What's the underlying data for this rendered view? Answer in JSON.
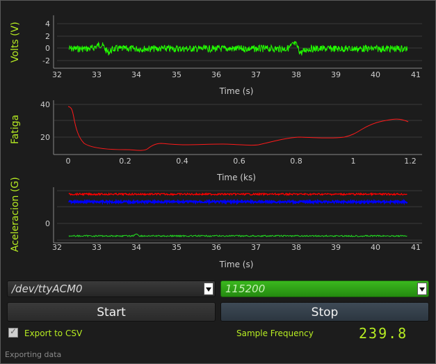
{
  "plots": {
    "volts": {
      "ylabel": "Volts (V)",
      "xlabel": "Time (s)",
      "yticks": [
        "4",
        "2",
        "0",
        "-2"
      ],
      "xticks": [
        "32",
        "33",
        "34",
        "35",
        "36",
        "37",
        "38",
        "39",
        "40",
        "41"
      ]
    },
    "fatiga": {
      "ylabel": "Fatiga",
      "xlabel": "Time (ks)",
      "yticks": [
        "40",
        "20"
      ],
      "xticks": [
        "0",
        "0.2",
        "0.4",
        "0.6",
        "0.8",
        "1",
        "1.2"
      ]
    },
    "accel": {
      "ylabel": "Aceleracion (G)",
      "xlabel": "Time (s)",
      "yticks": [
        "0"
      ],
      "xticks": [
        "32",
        "33",
        "34",
        "35",
        "36",
        "37",
        "38",
        "39",
        "40",
        "41"
      ]
    }
  },
  "controls": {
    "port_value": "/dev/ttyACM0",
    "baud_value": "115200",
    "start_label": "Start",
    "stop_label": "Stop",
    "export_label": "Export to CSV",
    "export_checked": true,
    "sample_freq_label": "Sample Frequency",
    "sample_freq_value": "239.8"
  },
  "status_text": "Exporting data",
  "colors": {
    "accent": "#b8ee22",
    "signal_green": "#22ff00",
    "fatigue_red": "#ff1a1a",
    "accel_red": "#ff0000",
    "accel_blue": "#0000ff",
    "accel_green": "#22dd22",
    "baud_combo_bg": "#2e9e16"
  }
}
